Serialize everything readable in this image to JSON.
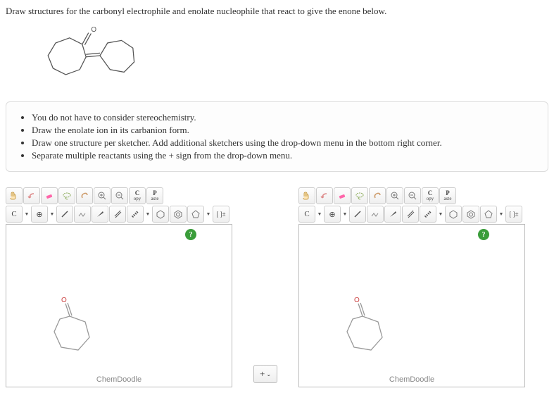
{
  "question": "Draw structures for the carbonyl electrophile and enolate nucleophile that react to give the enone below.",
  "instructions": [
    "You do not have to consider stereochemistry.",
    "Draw the enolate ion in its carbanion form.",
    "Draw one structure per sketcher. Add additional sketchers using the drop-down menu in the bottom right corner.",
    "Separate multiple reactants using the + sign from the drop-down menu."
  ],
  "toolbar": {
    "copy_top": "C",
    "copy_sub": "opy",
    "paste_top": "P",
    "paste_sub": "aste",
    "atom_c": "C",
    "brackets": "[ ]±"
  },
  "sketcher": {
    "footer": "ChemDoodle",
    "help": "?"
  },
  "plus_menu": "+"
}
